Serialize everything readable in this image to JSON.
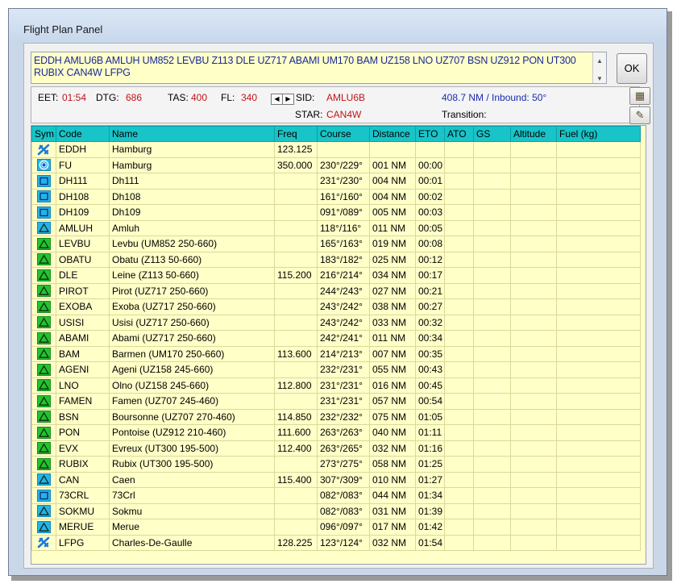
{
  "window": {
    "title": "Flight Plan Panel"
  },
  "route": {
    "text": "EDDH AMLU6B AMLUH UM852 LEVBU Z113 DLE UZ717 ABAMI UM170 BAM UZ158 LNO UZ707 BSN UZ912 PON UT300 RUBIX CAN4W LFPG"
  },
  "ok_label": "OK",
  "info": {
    "eet_label": "EET:",
    "eet_value": "01:54",
    "dtg_label": "DTG:",
    "dtg_value": "686",
    "tas_label": "TAS:",
    "tas_value": "400",
    "fl_label": "FL:",
    "fl_value": "340",
    "sid_label": "SID:",
    "sid_value": "AMLU6B",
    "star_label": "STAR:",
    "star_value": "CAN4W",
    "summary": "408.7 NM / Inbound: 50°",
    "transition_label": "Transition:"
  },
  "icons": {
    "spin_left": "arrow-left-icon",
    "spin_right": "arrow-right-icon",
    "calc": "calculator-icon",
    "tools": "tools-icon"
  },
  "columns": [
    "Sym",
    "Code",
    "Name",
    "Freq",
    "Course",
    "Distance",
    "ETO",
    "ATO",
    "GS",
    "Altitude",
    "Fuel (kg)"
  ],
  "rows": [
    {
      "sym": "airport",
      "code": "EDDH",
      "name": "Hamburg",
      "freq": "123.125",
      "course": "",
      "distance": "",
      "eto": ""
    },
    {
      "sym": "vor",
      "code": "FU",
      "name": "Hamburg",
      "freq": "350.000",
      "course": "230°/229°",
      "distance": "001 NM",
      "eto": "00:00"
    },
    {
      "sym": "square",
      "code": "DH111",
      "name": "Dh111",
      "freq": "",
      "course": "231°/230°",
      "distance": "004 NM",
      "eto": "00:01"
    },
    {
      "sym": "square",
      "code": "DH108",
      "name": "Dh108",
      "freq": "",
      "course": "161°/160°",
      "distance": "004 NM",
      "eto": "00:02"
    },
    {
      "sym": "square",
      "code": "DH109",
      "name": "Dh109",
      "freq": "",
      "course": "091°/089°",
      "distance": "005 NM",
      "eto": "00:03"
    },
    {
      "sym": "triangle-cyan",
      "code": "AMLUH",
      "name": "Amluh",
      "freq": "",
      "course": "118°/116°",
      "distance": "011 NM",
      "eto": "00:05"
    },
    {
      "sym": "triangle-green",
      "code": "LEVBU",
      "name": "Levbu (UM852 250-660)",
      "freq": "",
      "course": "165°/163°",
      "distance": "019 NM",
      "eto": "00:08"
    },
    {
      "sym": "triangle-green",
      "code": "OBATU",
      "name": "Obatu (Z113 50-660)",
      "freq": "",
      "course": "183°/182°",
      "distance": "025 NM",
      "eto": "00:12"
    },
    {
      "sym": "triangle-green",
      "code": "DLE",
      "name": "Leine (Z113 50-660)",
      "freq": "115.200",
      "course": "216°/214°",
      "distance": "034 NM",
      "eto": "00:17"
    },
    {
      "sym": "triangle-green",
      "code": "PIROT",
      "name": "Pirot (UZ717 250-660)",
      "freq": "",
      "course": "244°/243°",
      "distance": "027 NM",
      "eto": "00:21"
    },
    {
      "sym": "triangle-green",
      "code": "EXOBA",
      "name": "Exoba (UZ717 250-660)",
      "freq": "",
      "course": "243°/242°",
      "distance": "038 NM",
      "eto": "00:27"
    },
    {
      "sym": "triangle-green",
      "code": "USISI",
      "name": "Usisi (UZ717 250-660)",
      "freq": "",
      "course": "243°/242°",
      "distance": "033 NM",
      "eto": "00:32"
    },
    {
      "sym": "triangle-green",
      "code": "ABAMI",
      "name": "Abami (UZ717 250-660)",
      "freq": "",
      "course": "242°/241°",
      "distance": "011 NM",
      "eto": "00:34"
    },
    {
      "sym": "triangle-green",
      "code": "BAM",
      "name": "Barmen (UM170 250-660)",
      "freq": "113.600",
      "course": "214°/213°",
      "distance": "007 NM",
      "eto": "00:35"
    },
    {
      "sym": "triangle-green",
      "code": "AGENI",
      "name": "Ageni (UZ158 245-660)",
      "freq": "",
      "course": "232°/231°",
      "distance": "055 NM",
      "eto": "00:43"
    },
    {
      "sym": "triangle-green",
      "code": "LNO",
      "name": "Olno (UZ158 245-660)",
      "freq": "112.800",
      "course": "231°/231°",
      "distance": "016 NM",
      "eto": "00:45"
    },
    {
      "sym": "triangle-green",
      "code": "FAMEN",
      "name": "Famen (UZ707 245-460)",
      "freq": "",
      "course": "231°/231°",
      "distance": "057 NM",
      "eto": "00:54"
    },
    {
      "sym": "triangle-green",
      "code": "BSN",
      "name": "Boursonne (UZ707 270-460)",
      "freq": "114.850",
      "course": "232°/232°",
      "distance": "075 NM",
      "eto": "01:05"
    },
    {
      "sym": "triangle-green",
      "code": "PON",
      "name": "Pontoise (UZ912 210-460)",
      "freq": "111.600",
      "course": "263°/263°",
      "distance": "040 NM",
      "eto": "01:11"
    },
    {
      "sym": "triangle-green",
      "code": "EVX",
      "name": "Evreux (UT300 195-500)",
      "freq": "112.400",
      "course": "263°/265°",
      "distance": "032 NM",
      "eto": "01:16"
    },
    {
      "sym": "triangle-green",
      "code": "RUBIX",
      "name": "Rubix (UT300 195-500)",
      "freq": "",
      "course": "273°/275°",
      "distance": "058 NM",
      "eto": "01:25"
    },
    {
      "sym": "triangle-cyan",
      "code": "CAN",
      "name": "Caen",
      "freq": "115.400",
      "course": "307°/309°",
      "distance": "010 NM",
      "eto": "01:27"
    },
    {
      "sym": "square",
      "code": "73CRL",
      "name": "73Crl",
      "freq": "",
      "course": "082°/083°",
      "distance": "044 NM",
      "eto": "01:34"
    },
    {
      "sym": "triangle-cyan",
      "code": "SOKMU",
      "name": "Sokmu",
      "freq": "",
      "course": "082°/083°",
      "distance": "031 NM",
      "eto": "01:39"
    },
    {
      "sym": "triangle-cyan",
      "code": "MERUE",
      "name": "Merue",
      "freq": "",
      "course": "096°/097°",
      "distance": "017 NM",
      "eto": "01:42"
    },
    {
      "sym": "airport",
      "code": "LFPG",
      "name": "Charles-De-Gaulle",
      "freq": "128.225",
      "course": "123°/124°",
      "distance": "032 NM",
      "eto": "01:54"
    }
  ]
}
